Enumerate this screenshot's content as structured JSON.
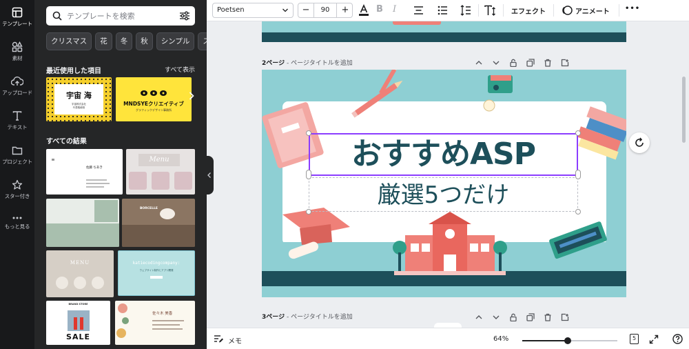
{
  "rail": {
    "items": [
      {
        "label": "テンプレート",
        "icon": "template-icon",
        "active": true
      },
      {
        "label": "素材",
        "icon": "elements-icon"
      },
      {
        "label": "アップロード",
        "icon": "upload-icon"
      },
      {
        "label": "テキスト",
        "icon": "text-icon"
      },
      {
        "label": "プロジェクト",
        "icon": "folder-icon"
      },
      {
        "label": "スター付き",
        "icon": "star-icon"
      },
      {
        "label": "もっと見る",
        "icon": "more-icon"
      }
    ]
  },
  "panel": {
    "search_placeholder": "テンプレートを検索",
    "chips": [
      "クリスマス",
      "花",
      "冬",
      "秋",
      "シンプル",
      "ス"
    ],
    "recent_title": "最近使用した項目",
    "see_all": "すべて表示",
    "recent": [
      {
        "title": "宇宙 海",
        "sub": "宇宙株式会社\n代表取締役"
      },
      {
        "title": "MNDSYEクリエイティブ",
        "sub": "グラフィックデザイン事務所"
      }
    ],
    "results_title": "すべての結果",
    "templates": {
      "t1_name": "佐藤 ちあき",
      "t2_title": "Menu",
      "t4_title": "BORCELLE",
      "t5_title": "MENU",
      "t6_title": "katiecodingcompany:",
      "t6_sub": "ウェブサイト制作とアプリ開発",
      "t7_title": "SALE",
      "t7_brand": "BRAND STORE",
      "t8_name": "佐々木 美香"
    }
  },
  "toolbar": {
    "font": "Poetsen",
    "font_size": "90",
    "effect_label": "エフェクト",
    "animate_label": "アニメート",
    "more_label": "•••"
  },
  "canvas": {
    "page2_label_bold": "2ページ",
    "page2_label_rest": " - ページタイトルを追加",
    "page3_label_bold": "3ページ",
    "page3_label_rest": " - ページタイトルを追加",
    "slide_title": "おすすめASP",
    "slide_subtitle": "厳選5つだけ",
    "colors": {
      "teal": "#8ecfd3",
      "dark_teal": "#1d4f5a",
      "coral": "#ef8078",
      "selection": "#8b3dff"
    }
  },
  "bottombar": {
    "notes_label": "メモ",
    "zoom": "64%",
    "zoom_fraction": 0.48,
    "page_count": "5"
  }
}
